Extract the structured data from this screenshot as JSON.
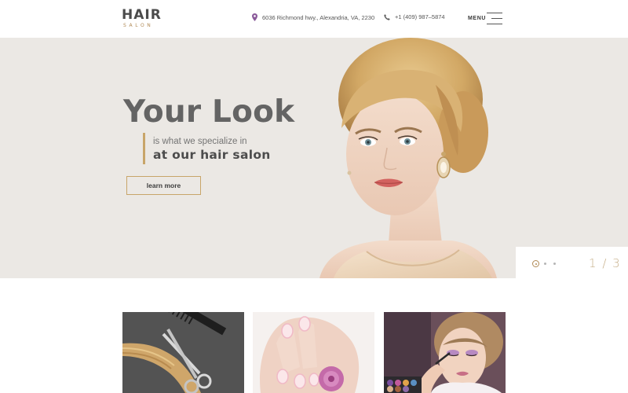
{
  "header": {
    "logo_main": "HAIR",
    "logo_sub": "SALON",
    "address": "6036 Richmond hwy., Alexandria, VA, 2230",
    "phone": "+1 (409) 987–5874",
    "menu_label": "MENU"
  },
  "hero": {
    "title": "Your Look",
    "subtitle_line1": "is what we specialize in",
    "subtitle_line2": "at our hair salon",
    "button_label": "learn more",
    "slide_current": "1",
    "slide_separator": "/",
    "slide_total": "3"
  },
  "services": {
    "cards": [
      {
        "icon": "hair-scissors-comb-image"
      },
      {
        "icon": "manicure-nails-image"
      },
      {
        "icon": "makeup-model-image"
      }
    ]
  },
  "colors": {
    "accent_gold": "#c8a569",
    "hero_background": "#ebe8e4",
    "text_dark": "#646464",
    "icon_purple": "#8a5a9a"
  }
}
